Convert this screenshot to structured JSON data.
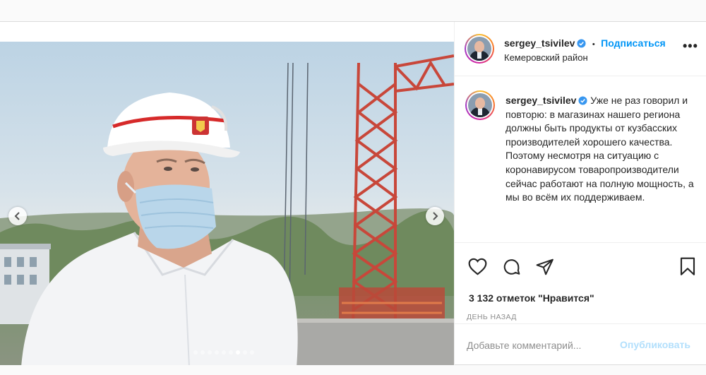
{
  "post": {
    "author": {
      "username": "sergey_tsivilev",
      "verified": true,
      "location": "Кемеровский район"
    },
    "follow_label": "Подписаться",
    "separator": "•",
    "more_label": "•••",
    "caption": "Уже не раз говорил и повторю: в магазинах нашего региона должны быть продукты от кузбасских производителей хорошего качества. Поэтому несмотря на ситуацию с коронавирусом товаропроизводители сейчас работают на полную мощность, а мы во всём их поддерживаем.",
    "likes": "3 132 отметок \"Нравится\"",
    "timestamp": "ДЕНЬ НАЗАД",
    "comment_placeholder": "Добавьте комментарий...",
    "publish_label": "Опубликовать"
  },
  "carousel": {
    "total_slides": 9,
    "active_slide": 7
  },
  "icons": {
    "like": "heart-icon",
    "comment": "comment-bubble-icon",
    "share": "paper-plane-icon",
    "save": "bookmark-icon",
    "prev": "chevron-left-icon",
    "next": "chevron-right-icon",
    "verified": "verified-badge-icon"
  },
  "colors": {
    "accent": "#0095f6",
    "publish_disabled": "#b2dffc",
    "muted": "#8e8e8e",
    "text": "#262626"
  }
}
